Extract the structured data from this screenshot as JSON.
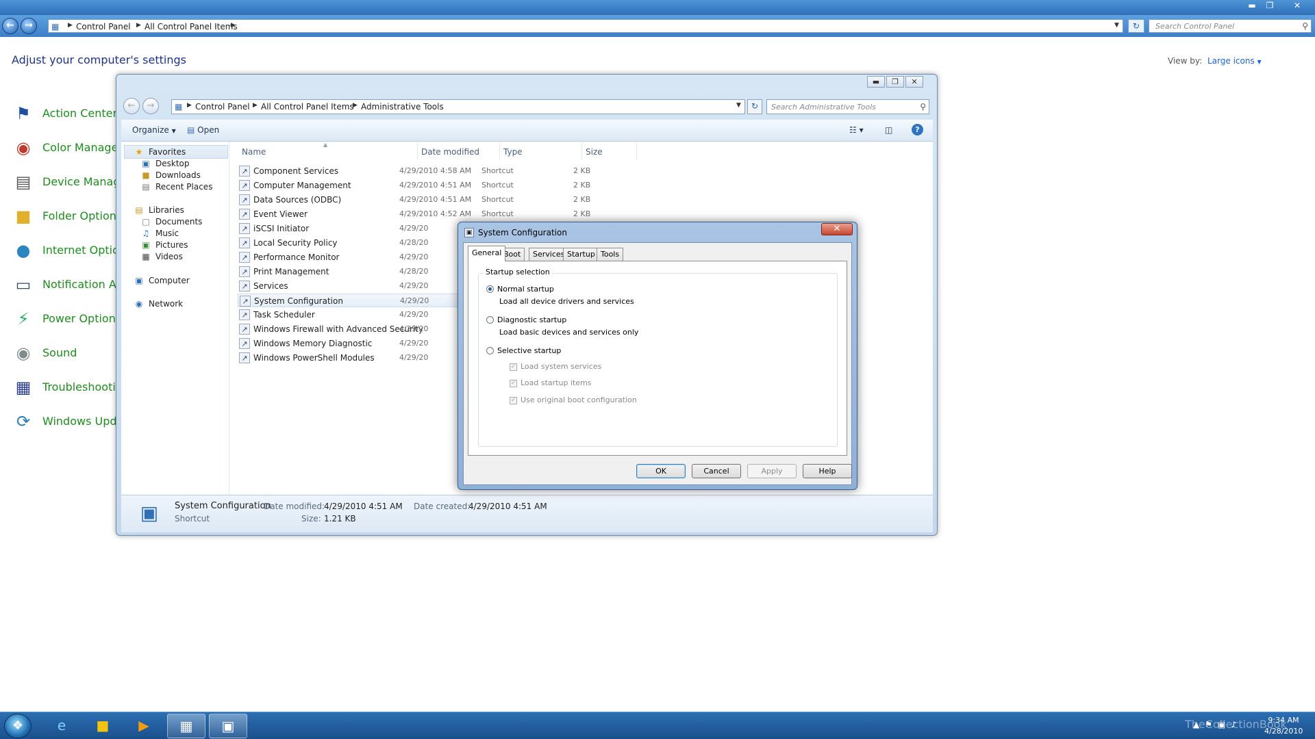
{
  "control_panel": {
    "breadcrumbs": [
      "Control Panel",
      "All Control Panel Items"
    ],
    "search_placeholder": "Search Control Panel",
    "heading": "Adjust your computer's settings",
    "view_by_label": "View by:",
    "view_by_value": "Large icons",
    "items": [
      {
        "label": "Action Center",
        "icon": "flag-icon"
      },
      {
        "label": "Color Managem",
        "icon": "color-management-icon"
      },
      {
        "label": "Device Manage",
        "icon": "device-manager-icon"
      },
      {
        "label": "Folder Options",
        "icon": "folder-icon"
      },
      {
        "label": "Internet Option",
        "icon": "globe-icon"
      },
      {
        "label": "Notification Are",
        "icon": "notification-area-icon"
      },
      {
        "label": "Power Options",
        "icon": "power-icon"
      },
      {
        "label": "Sound",
        "icon": "speaker-icon"
      },
      {
        "label": "Troubleshootin",
        "icon": "troubleshooting-icon"
      },
      {
        "label": "Windows Upda",
        "icon": "windows-update-icon"
      }
    ]
  },
  "admin_tools": {
    "breadcrumbs": [
      "Control Panel",
      "All Control Panel Items",
      "Administrative Tools"
    ],
    "search_placeholder": "Search Administrative Tools",
    "toolbar": {
      "organize": "Organize",
      "open": "Open"
    },
    "nav": {
      "favorites": "Favorites",
      "favorites_items": [
        "Desktop",
        "Downloads",
        "Recent Places"
      ],
      "libraries": "Libraries",
      "libraries_items": [
        "Documents",
        "Music",
        "Pictures",
        "Videos"
      ],
      "computer": "Computer",
      "network": "Network"
    },
    "columns": {
      "name": "Name",
      "date": "Date modified",
      "type": "Type",
      "size": "Size"
    },
    "files": [
      {
        "name": "Component Services",
        "date": "4/29/2010 4:58 AM",
        "type": "Shortcut",
        "size": "2 KB"
      },
      {
        "name": "Computer Management",
        "date": "4/29/2010 4:51 AM",
        "type": "Shortcut",
        "size": "2 KB"
      },
      {
        "name": "Data Sources (ODBC)",
        "date": "4/29/2010 4:51 AM",
        "type": "Shortcut",
        "size": "2 KB"
      },
      {
        "name": "Event Viewer",
        "date": "4/29/2010 4:52 AM",
        "type": "Shortcut",
        "size": "2 KB"
      },
      {
        "name": "iSCSI Initiator",
        "date": "4/29/20",
        "type": "",
        "size": ""
      },
      {
        "name": "Local Security Policy",
        "date": "4/28/20",
        "type": "",
        "size": ""
      },
      {
        "name": "Performance Monitor",
        "date": "4/29/20",
        "type": "",
        "size": ""
      },
      {
        "name": "Print Management",
        "date": "4/28/20",
        "type": "",
        "size": ""
      },
      {
        "name": "Services",
        "date": "4/29/20",
        "type": "",
        "size": ""
      },
      {
        "name": "System Configuration",
        "date": "4/29/20",
        "type": "",
        "size": ""
      },
      {
        "name": "Task Scheduler",
        "date": "4/29/20",
        "type": "",
        "size": ""
      },
      {
        "name": "Windows Firewall with Advanced Security",
        "date": "4/29/20",
        "type": "",
        "size": ""
      },
      {
        "name": "Windows Memory Diagnostic",
        "date": "4/29/20",
        "type": "",
        "size": ""
      },
      {
        "name": "Windows PowerShell Modules",
        "date": "4/29/20",
        "type": "",
        "size": ""
      }
    ],
    "details": {
      "name": "System Configuration",
      "kind": "Shortcut",
      "date_modified_label": "Date modified:",
      "date_modified": "4/29/2010 4:51 AM",
      "size_label": "Size:",
      "size": "1.21 KB",
      "date_created_label": "Date created:",
      "date_created": "4/29/2010 4:51 AM"
    }
  },
  "system_config": {
    "title": "System Configuration",
    "tabs": [
      "General",
      "Boot",
      "Services",
      "Startup",
      "Tools"
    ],
    "active_tab": "General",
    "group_label": "Startup selection",
    "normal_startup": "Normal startup",
    "normal_desc": "Load all device drivers and services",
    "diagnostic_startup": "Diagnostic startup",
    "diagnostic_desc": "Load basic devices and services only",
    "selective_startup": "Selective startup",
    "load_system_services": "Load system services",
    "load_startup_items": "Load startup items",
    "use_original_boot": "Use original boot configuration",
    "buttons": {
      "ok": "OK",
      "cancel": "Cancel",
      "apply": "Apply",
      "help": "Help"
    }
  },
  "taskbar": {
    "time": "9:34 AM",
    "date": "4/28/2010",
    "watermark": "TheCollectionBook"
  }
}
